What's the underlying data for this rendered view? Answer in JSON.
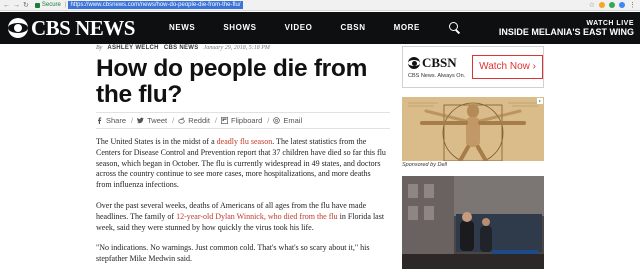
{
  "browser": {
    "secure_label": "Secure",
    "url": "https://www.cbsnews.com/news/how-do-people-die-from-the-flu/"
  },
  "site": {
    "logo_text": "CBS NEWS",
    "nav": [
      "NEWS",
      "SHOWS",
      "VIDEO",
      "CBSN",
      "MORE"
    ],
    "watch_live": "WATCH LIVE",
    "live_headline": "INSIDE MELANIA'S EAST WING"
  },
  "article": {
    "by_prefix": "By",
    "author": "ASHLEY WELCH",
    "section": "CBS NEWS",
    "date": "January 29, 2018, 5:18 PM",
    "headline": "How do people die from the flu?",
    "share": [
      {
        "label": "Share",
        "icon": "facebook-icon"
      },
      {
        "label": "Tweet",
        "icon": "twitter-icon"
      },
      {
        "label": "Reddit",
        "icon": "reddit-icon"
      },
      {
        "label": "Flipboard",
        "icon": "flipboard-icon"
      },
      {
        "label": "Email",
        "icon": "email-icon"
      }
    ],
    "p1_a": "The United States is in the midst of a ",
    "p1_link": "deadly flu season",
    "p1_b": ". The latest statistics from the Centers for Disease Control and Prevention report that 37 children have died so far this flu season, which began in October. The flu is currently widespread in 49 states, and doctors across the country continue to see more cases, more hospitalizations, and more deaths from influenza infections.",
    "p2_a": "Over the past several weeks, deaths of Americans of all ages from the flu have made headlines. The family of ",
    "p2_link": "12-year-old Dylan Winnick, who died from the flu",
    "p2_b": " in Florida last week, said they were stunned by how quickly the virus took his life.",
    "p3": "\"No indications. No warnings. Just common cold. That's what's so scary about it,\" his stepfather Mike Medwin said."
  },
  "ads": {
    "cbsn_logo": "CBSN",
    "cbsn_tagline": "CBS News. Always On.",
    "watch_now": "Watch Now ›",
    "sponsored": "Sponsored by Dell"
  },
  "colors": {
    "nav_bg": "#0e0f11",
    "link": "#c0392b",
    "watch_now": "#dd3333"
  }
}
